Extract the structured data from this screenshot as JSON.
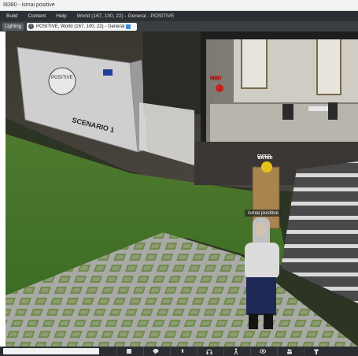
{
  "window": {
    "title": "I8380 - ismai positive"
  },
  "menu": {
    "items": [
      "Build",
      "Content",
      "Help"
    ],
    "location": "World (167, 100, 22) - General - POSITIVE"
  },
  "nav": {
    "lighting_label": "Lighting",
    "address": "POSITIVE, World (167, 100, 22) - General"
  },
  "scene": {
    "sign_title": "SCENARIO 1",
    "sign_logo_text": "POSITIVE",
    "enter_label": "ENTER",
    "hint_label": "HINT",
    "avatar_name": "ismai positive"
  },
  "toolbar": {
    "icons": [
      "build-icon",
      "chat-icon",
      "speak-icon",
      "headset-icon",
      "move-icon",
      "view-icon",
      "people-icon",
      "appearance-icon"
    ]
  }
}
